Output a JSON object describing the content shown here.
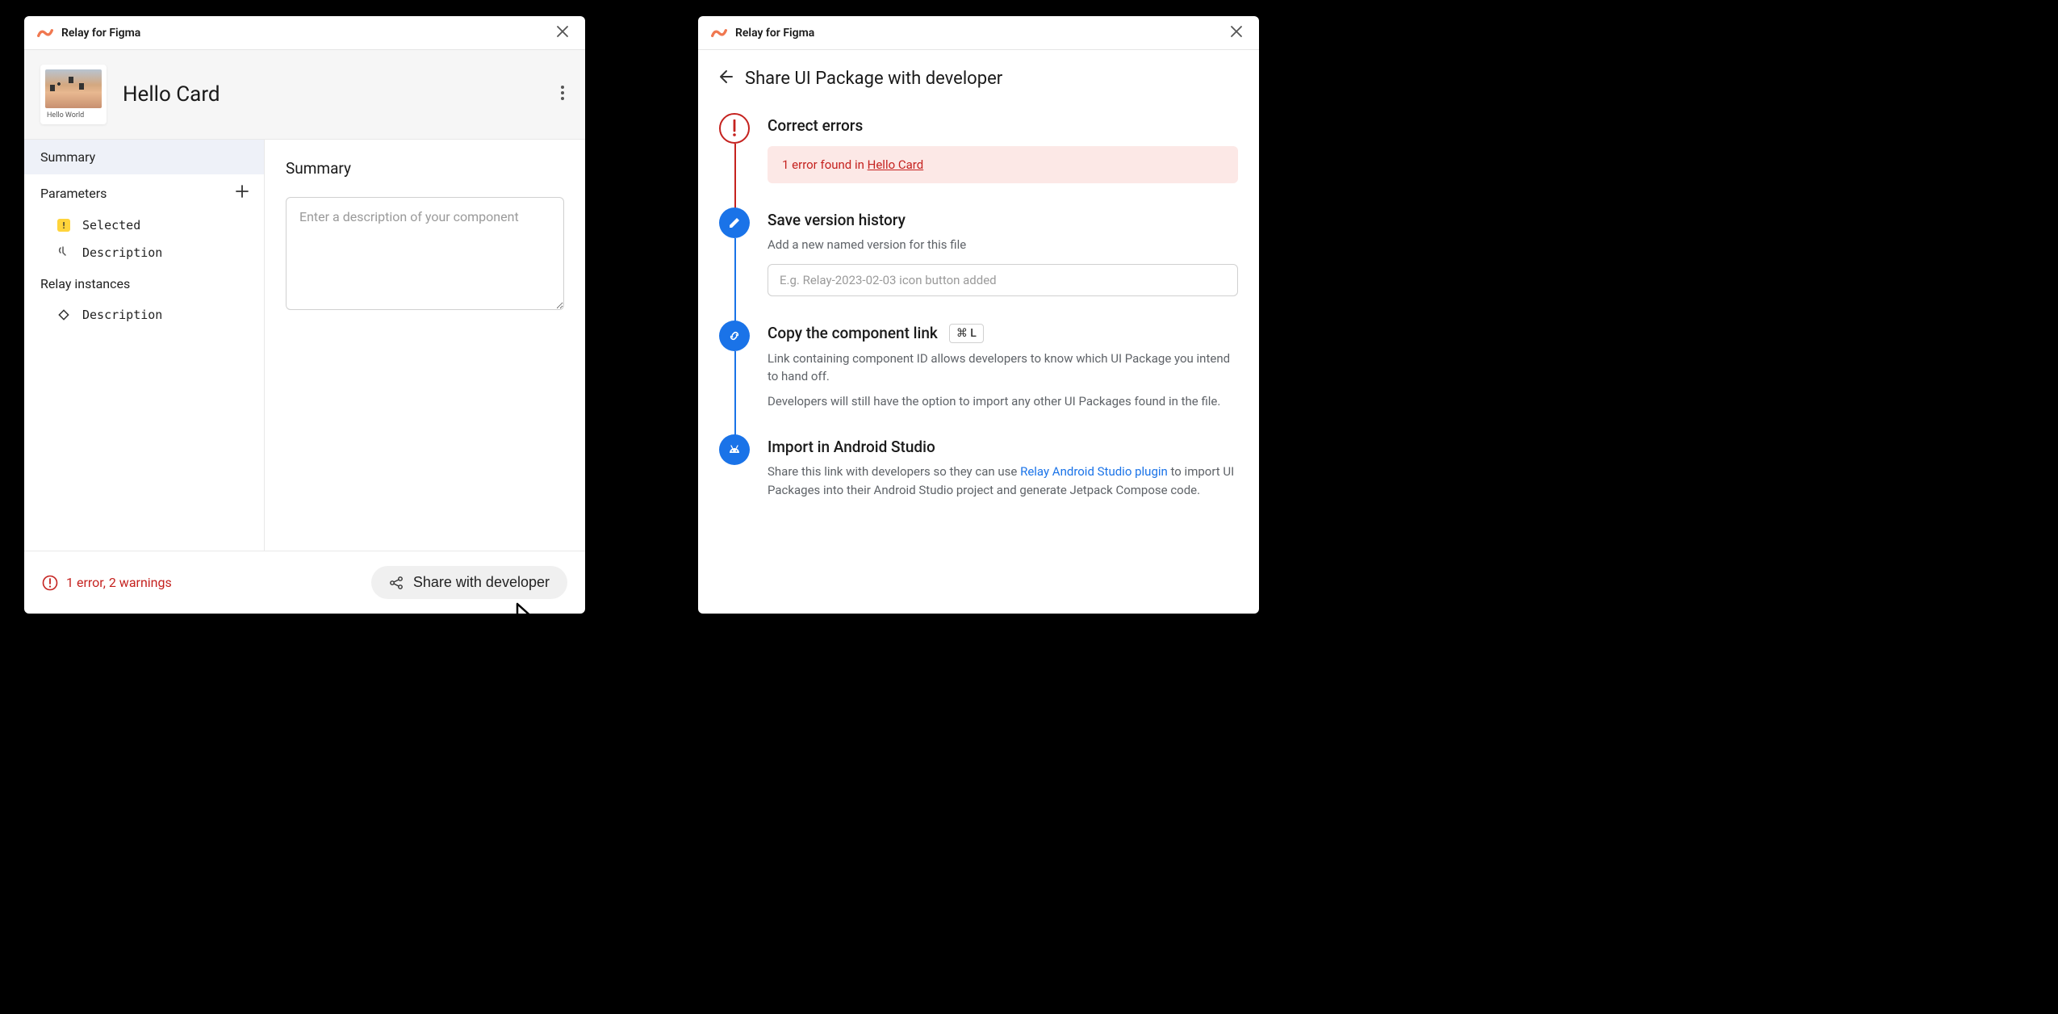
{
  "app_title": "Relay for Figma",
  "left": {
    "component_name": "Hello Card",
    "thumb_label": "Hello World",
    "sidebar": {
      "summary": "Summary",
      "parameters": "Parameters",
      "param_items": [
        {
          "label": "Selected"
        },
        {
          "label": "Description"
        }
      ],
      "relay_instances": "Relay instances",
      "relay_items": [
        {
          "label": "Description"
        }
      ]
    },
    "main": {
      "heading": "Summary",
      "placeholder": "Enter a description of your component"
    },
    "footer": {
      "error_text": "1 error, 2 warnings",
      "share_label": "Share with developer"
    }
  },
  "right": {
    "title": "Share UI Package with developer",
    "steps": {
      "correct": {
        "title": "Correct errors",
        "error_prefix": "1 error found in ",
        "error_link": "Hello Card"
      },
      "save": {
        "title": "Save version history",
        "subtitle": "Add a new named version for this file",
        "placeholder": "E.g. Relay-2023-02-03 icon button added"
      },
      "copy": {
        "title": "Copy the component link",
        "shortcut": "⌘ L",
        "para1": "Link containing component ID allows developers to know which UI Package you intend to hand off.",
        "para2": "Developers will still have the option to import any other UI Packages found in the file."
      },
      "import": {
        "title": "Import in Android Studio",
        "para_pre": "Share this link with developers so they can use ",
        "para_link": "Relay Android Studio plugin",
        "para_post": " to import UI Packages into their Android Studio project and generate Jetpack Compose code."
      }
    }
  }
}
